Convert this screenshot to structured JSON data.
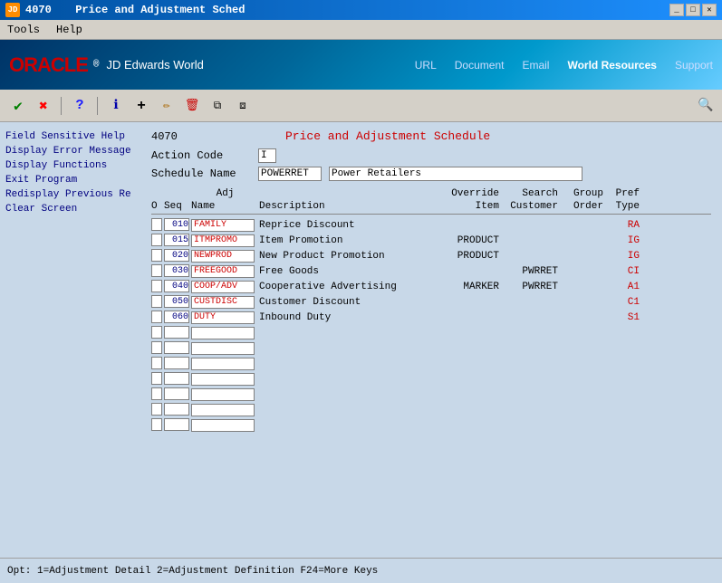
{
  "titlebar": {
    "app_id": "4070",
    "title": "Price and Adjustment Sched",
    "icon_label": "JD"
  },
  "menubar": {
    "items": [
      "Tools",
      "Help"
    ]
  },
  "oracle_header": {
    "logo_oracle": "ORACLE",
    "logo_jde": "JD Edwards World",
    "nav_items": [
      "URL",
      "Document",
      "Email",
      "World Resources",
      "Support"
    ]
  },
  "toolbar": {
    "check_icon": "✔",
    "x_icon": "✖",
    "help_icon": "?",
    "info_icon": "ℹ",
    "add_icon": "+",
    "edit_icon": "✏",
    "delete_icon": "🗑",
    "copy_icon": "⧉",
    "paste_icon": "⧈",
    "search_icon": "🔍"
  },
  "left_nav": {
    "items": [
      "Field Sensitive Help",
      "Display Error Message",
      "Display Functions",
      "Exit Program",
      "Redisplay Previous Re",
      "Clear Screen"
    ]
  },
  "form": {
    "app_id": "4070",
    "form_title": "Price and Adjustment Schedule",
    "action_code_label": "Action Code",
    "action_code_value": "I",
    "schedule_name_label": "Schedule Name",
    "schedule_name_value": "POWERRET",
    "schedule_desc_value": "Power Retailers"
  },
  "table": {
    "header1": {
      "adj": "Adj",
      "override": "Override",
      "search": "Search",
      "group": "Group",
      "pref": "Pref"
    },
    "header2": {
      "o": "O",
      "seq": "Seq",
      "name": "Name",
      "description": "Description",
      "item": "Item",
      "customer": "Customer",
      "order": "Order",
      "type": "Type"
    },
    "rows": [
      {
        "seq": "010",
        "adj": "FAMILY",
        "desc": "Reprice Discount",
        "override": "",
        "search": "",
        "group": "",
        "pref": "RA"
      },
      {
        "seq": "015",
        "adj": "ITMPROMO",
        "desc": "Item Promotion",
        "override": "PRODUCT",
        "search": "",
        "group": "",
        "pref": "IG"
      },
      {
        "seq": "020",
        "adj": "NEWPROD",
        "desc": "New Product Promotion",
        "override": "PRODUCT",
        "search": "",
        "group": "",
        "pref": "IG"
      },
      {
        "seq": "030",
        "adj": "FREEGOOD",
        "desc": "Free Goods",
        "override": "",
        "search": "PWRRET",
        "group": "",
        "pref": "CI"
      },
      {
        "seq": "040",
        "adj": "COOP/ADV",
        "desc": "Cooperative Advertising",
        "override": "MARKER",
        "search": "PWRRET",
        "group": "",
        "pref": "A1"
      },
      {
        "seq": "050",
        "adj": "CUSTDISC",
        "desc": "Customer Discount",
        "override": "",
        "search": "",
        "group": "",
        "pref": "C1"
      },
      {
        "seq": "060",
        "adj": "DUTY",
        "desc": "Inbound Duty",
        "override": "",
        "search": "",
        "group": "",
        "pref": "S1"
      }
    ]
  },
  "status_bar": {
    "text": "Opt:  1=Adjustment Detail   2=Adjustment Definition               F24=More Keys"
  },
  "colors": {
    "red": "#cc0000",
    "blue": "#000080",
    "header_bg": "#003366"
  }
}
